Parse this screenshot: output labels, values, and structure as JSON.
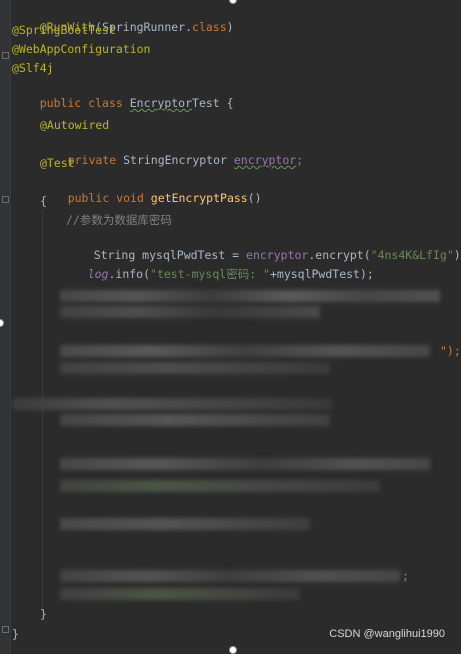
{
  "code": {
    "line1": {
      "ann": "@RunWith",
      "rest1": "(SpringRunner.",
      "kw": "class",
      "rest2": ")"
    },
    "line2": "@SpringBootTest",
    "line3": "@WebAppConfiguration",
    "line4": "@Slf4j",
    "line5": {
      "kw": "public class ",
      "name": "Encryptor",
      "name2": "Test",
      "brace": " {"
    },
    "line6": "@Autowired",
    "line7": {
      "kw": "private ",
      "type": "StringEncryptor ",
      "field": "encryptor",
      "semi": ";"
    },
    "line8": "@Test",
    "line9": {
      "kw": "public void ",
      "fn": "getEncryptPass",
      "rest": "()"
    },
    "line10": "{",
    "line11": "//参数为数据库密码",
    "line12": {
      "a": "String mysqlPwdTest = ",
      "field": "encryptor",
      "b": ".encrypt(",
      "str": "\"4ns4K&LfIg\"",
      "c": ");"
    },
    "line13": {
      "log": "log",
      "a": ".info(",
      "str": "\"test-mysql密码: \"",
      "b": "+mysqlPwdTest);"
    },
    "frag1": "\");",
    "frag2": ";",
    "close_method": "}",
    "close_class": "}"
  },
  "watermark": "CSDN @wanglihui1990",
  "colors": {
    "background": "#2b2b2b",
    "annotation": "#bbb529",
    "keyword": "#cc7832",
    "string": "#6a8759",
    "field": "#9876aa",
    "method": "#ffc66d",
    "comment": "#808080"
  }
}
